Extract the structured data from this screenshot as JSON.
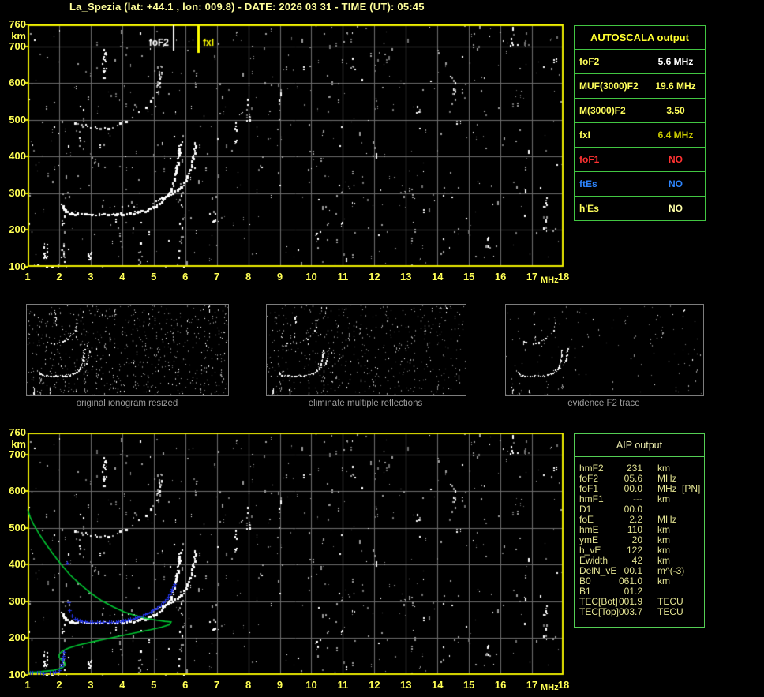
{
  "title": "La_Spezia (lat: +44.1 , lon: 009.8) - DATE: 2026 03 31  - TIME (UT): 05:45",
  "colors": {
    "background": "#000000",
    "plot_border": "#eded00",
    "grid": "#6e6e6e",
    "axis_label": "#ffff55",
    "table_border": "#42c642",
    "profile_green": "#00c832",
    "restored_blue": "#2334e6",
    "noise_gray": "#9a9a9a",
    "echo_white": "#ffffff"
  },
  "autoscala": {
    "header": "AUTOSCALA output",
    "rows": [
      {
        "label": "foF2",
        "value": "5.6 MHz",
        "label_color": "#ffff5c",
        "value_color": "#ffffff"
      },
      {
        "label": "MUF(3000)F2",
        "value": "19.6 MHz",
        "label_color": "#ffff5c",
        "value_color": "#ffff5c"
      },
      {
        "label": "M(3000)F2",
        "value": "3.50",
        "label_color": "#ffff5c",
        "value_color": "#ffff5c"
      },
      {
        "label": "fxI",
        "value": "6.4 MHz",
        "label_color": "#ffff5c",
        "value_color": "#c9c900"
      },
      {
        "label": "foF1",
        "value": "NO",
        "label_color": "#ff3232",
        "value_color": "#ff3232"
      },
      {
        "label": "ftEs",
        "value": "NO",
        "label_color": "#2e86ff",
        "value_color": "#2e86ff"
      },
      {
        "label": "h'Es",
        "value": "NO",
        "label_color": "#ffff5c",
        "value_color": "#ffffa8"
      }
    ]
  },
  "aip": {
    "header": "AIP output",
    "rows": [
      {
        "label": "hmF2",
        "value": "231",
        "unit": "km",
        "note": ""
      },
      {
        "label": "foF2",
        "value": "05.6",
        "unit": "MHz",
        "note": ""
      },
      {
        "label": "foF1",
        "value": "00.0",
        "unit": "MHz",
        "note": "[PN]"
      },
      {
        "label": "hmF1",
        "value": "---",
        "unit": "km",
        "note": ""
      },
      {
        "label": "D1",
        "value": "00.0",
        "unit": "",
        "note": ""
      },
      {
        "label": "foE",
        "value": "2.2",
        "unit": "MHz",
        "note": ""
      },
      {
        "label": "hmE",
        "value": "110",
        "unit": "km",
        "note": ""
      },
      {
        "label": "ymE",
        "value": "20",
        "unit": "km",
        "note": ""
      },
      {
        "label": "h_vE",
        "value": "122",
        "unit": "km",
        "note": ""
      },
      {
        "label": "Ewidth",
        "value": "42",
        "unit": "km",
        "note": ""
      },
      {
        "label": "DelN_vE",
        "value": "00.1",
        "unit": "m^(-3)",
        "note": ""
      },
      {
        "label": "B0",
        "value": "061.0",
        "unit": "km",
        "note": ""
      },
      {
        "label": "B1",
        "value": "01.2",
        "unit": "",
        "note": ""
      },
      {
        "label": "TEC[Bot]",
        "value": "001.9",
        "unit": "TECU",
        "note": ""
      },
      {
        "label": "TEC[Top]",
        "value": "003.7",
        "unit": "TECU",
        "note": ""
      }
    ]
  },
  "thumbnails": {
    "captions": [
      "original ionogram resized",
      "eliminate multiple reflections",
      "evidence F2 trace"
    ]
  },
  "chart_data": [
    {
      "id": "ionogram-top",
      "type": "scatter",
      "xlabel": "MHz",
      "ylabel": "km",
      "xlim": [
        1,
        18
      ],
      "ylim": [
        100,
        760
      ],
      "x_ticks": [
        "1",
        "2",
        "3",
        "4",
        "5",
        "6",
        "7",
        "8",
        "9",
        "10",
        "11",
        "12",
        "13",
        "14",
        "15",
        "16",
        "17",
        "18"
      ],
      "y_ticks": [
        760,
        700,
        600,
        500,
        400,
        300,
        200,
        100
      ],
      "grid": "1 MHz vertical, 100 km horizontal",
      "markers": [
        {
          "label": "foF2",
          "MHz": 5.6,
          "color": "#ffffff"
        },
        {
          "label": "fxI",
          "MHz": 6.4,
          "color": "#ffff00"
        }
      ],
      "series": [
        {
          "name": "F2 trace O-mode",
          "color": "#ffffff",
          "points": [
            [
              2.05,
              272
            ],
            [
              2.1,
              262
            ],
            [
              2.2,
              252
            ],
            [
              2.35,
              247
            ],
            [
              2.6,
              245
            ],
            [
              3.0,
              244
            ],
            [
              3.4,
              244
            ],
            [
              3.8,
              245
            ],
            [
              4.2,
              247
            ],
            [
              4.5,
              251
            ],
            [
              4.8,
              257
            ],
            [
              5.0,
              264
            ],
            [
              5.15,
              272
            ],
            [
              5.3,
              283
            ],
            [
              5.45,
              298
            ],
            [
              5.55,
              315
            ],
            [
              5.63,
              335
            ],
            [
              5.69,
              358
            ],
            [
              5.74,
              384
            ],
            [
              5.78,
              412
            ],
            [
              5.8,
              436
            ]
          ]
        },
        {
          "name": "F2 trace X-mode",
          "color": "#ffffff",
          "points": [
            [
              5.05,
              283
            ],
            [
              5.25,
              289
            ],
            [
              5.45,
              296
            ],
            [
              5.65,
              306
            ],
            [
              5.85,
              320
            ],
            [
              6.0,
              337
            ],
            [
              6.1,
              356
            ],
            [
              6.18,
              378
            ],
            [
              6.24,
              402
            ],
            [
              6.28,
              424
            ],
            [
              6.3,
              442
            ]
          ]
        },
        {
          "name": "second-hop echo",
          "color": "#cccccc",
          "points": [
            [
              2.45,
              495
            ],
            [
              2.7,
              488
            ],
            [
              3.0,
              482
            ],
            [
              3.3,
              479
            ],
            [
              3.55,
              481
            ],
            [
              3.8,
              487
            ],
            [
              4.1,
              500
            ],
            [
              4.4,
              517
            ],
            [
              4.7,
              535
            ],
            [
              4.9,
              553
            ],
            [
              5.05,
              577
            ],
            [
              5.15,
              602
            ],
            [
              5.22,
              628
            ],
            [
              5.26,
              648
            ]
          ]
        },
        {
          "name": "flat echo segment",
          "color": "#dddddd",
          "points": [
            [
              3.25,
              262
            ],
            [
              3.6,
              264
            ],
            [
              4.0,
              266
            ],
            [
              4.35,
              268
            ]
          ]
        },
        {
          "name": "E-region echoes",
          "color": "#ffffff",
          "points": [
            [
              1.02,
              104
            ],
            [
              1.3,
              105
            ],
            [
              1.6,
              105
            ],
            [
              1.9,
              106
            ]
          ]
        }
      ]
    },
    {
      "id": "ionogram-bottom",
      "type": "scatter",
      "xlabel": "MHz",
      "ylabel": "km",
      "xlim": [
        1,
        18
      ],
      "ylim": [
        100,
        760
      ],
      "x_ticks": [
        "1",
        "2",
        "3",
        "4",
        "5",
        "6",
        "7",
        "8",
        "9",
        "10",
        "11",
        "12",
        "13",
        "14",
        "15",
        "16",
        "17",
        "18"
      ],
      "y_ticks": [
        760,
        700,
        600,
        500,
        400,
        300,
        200,
        100
      ],
      "note": "white echo background identical to top ionogram",
      "series": [
        {
          "name": "electron density profile",
          "color": "#00c832",
          "points": [
            [
              1.0,
              551
            ],
            [
              1.08,
              530
            ],
            [
              1.2,
              508
            ],
            [
              1.35,
              486
            ],
            [
              1.55,
              460
            ],
            [
              1.8,
              430
            ],
            [
              2.05,
              402
            ],
            [
              2.35,
              372
            ],
            [
              2.65,
              348
            ],
            [
              3.0,
              323
            ],
            [
              3.35,
              302
            ],
            [
              3.7,
              286
            ],
            [
              4.05,
              272
            ],
            [
              4.4,
              262
            ],
            [
              4.75,
              254
            ],
            [
              5.1,
              249
            ],
            [
              5.35,
              246
            ],
            [
              5.55,
              244
            ],
            [
              5.5,
              237
            ],
            [
              5.25,
              230
            ],
            [
              4.9,
              223
            ],
            [
              4.5,
              216
            ],
            [
              4.05,
              208
            ],
            [
              3.55,
              199
            ],
            [
              3.05,
              190
            ],
            [
              2.6,
              181
            ],
            [
              2.3,
              173
            ],
            [
              2.1,
              165
            ],
            [
              2.0,
              156
            ],
            [
              2.0,
              148
            ],
            [
              2.07,
              141
            ],
            [
              2.17,
              134
            ],
            [
              2.2,
              128
            ],
            [
              2.12,
              121
            ],
            [
              1.98,
              116
            ],
            [
              1.8,
              112
            ],
            [
              1.55,
              110
            ],
            [
              1.3,
              108
            ],
            [
              1.05,
              107
            ]
          ]
        },
        {
          "name": "restored F trace",
          "color": "#2334e6",
          "points": [
            [
              2.4,
              262
            ],
            [
              2.5,
              253
            ],
            [
              2.65,
              248
            ],
            [
              2.9,
              245
            ],
            [
              3.2,
              243
            ],
            [
              3.5,
              243
            ],
            [
              3.8,
              245
            ],
            [
              4.1,
              249
            ],
            [
              4.4,
              255
            ],
            [
              4.65,
              262
            ],
            [
              4.9,
              272
            ],
            [
              5.1,
              283
            ],
            [
              5.3,
              297
            ],
            [
              5.45,
              312
            ],
            [
              5.55,
              327
            ],
            [
              5.62,
              340
            ],
            [
              5.65,
              348
            ]
          ]
        },
        {
          "name": "restored F stray points",
          "color": "#2334e6",
          "points": [
            [
              2.25,
              406
            ],
            [
              2.3,
              297
            ],
            [
              2.33,
              276
            ]
          ]
        },
        {
          "name": "restored E trace",
          "color": "#2334e6",
          "points": [
            [
              1.0,
              107
            ],
            [
              1.15,
              106
            ],
            [
              1.3,
              106
            ],
            [
              1.5,
              105
            ],
            [
              1.7,
              106
            ],
            [
              1.88,
              108
            ],
            [
              2.0,
              113
            ],
            [
              2.07,
              124
            ],
            [
              2.1,
              138
            ],
            [
              2.13,
              152
            ],
            [
              2.16,
              162
            ]
          ]
        }
      ]
    }
  ],
  "noise": {
    "seed": 7,
    "count": 620,
    "clusters": [
      [
        3.42,
        615,
        710,
        16,
        1
      ],
      [
        5.15,
        590,
        655,
        9,
        0
      ],
      [
        2.12,
        100,
        240,
        14,
        0
      ],
      [
        5.85,
        110,
        420,
        20,
        0
      ],
      [
        7.6,
        435,
        500,
        8,
        0
      ],
      [
        8.0,
        495,
        560,
        7,
        0
      ],
      [
        14.5,
        545,
        620,
        11,
        0
      ],
      [
        17.4,
        200,
        300,
        11,
        0
      ],
      [
        16.35,
        700,
        758,
        8,
        1
      ],
      [
        1.55,
        115,
        162,
        12,
        1
      ],
      [
        2.95,
        118,
        152,
        10,
        1
      ],
      [
        12.0,
        390,
        452,
        6,
        0
      ],
      [
        13.4,
        478,
        540,
        5,
        0
      ],
      [
        15.6,
        128,
        190,
        6,
        0
      ],
      [
        10.2,
        148,
        210,
        5,
        0
      ],
      [
        6.9,
        218,
        300,
        7,
        0
      ],
      [
        9.0,
        538,
        600,
        5,
        0
      ],
      [
        11.3,
        618,
        680,
        5,
        0
      ],
      [
        4.55,
        100,
        168,
        7,
        0
      ],
      [
        2.6,
        428,
        470,
        5,
        0
      ]
    ],
    "thumb_counts": [
      640,
      500,
      110
    ],
    "thumb_seeds": [
      11,
      12,
      13
    ]
  }
}
